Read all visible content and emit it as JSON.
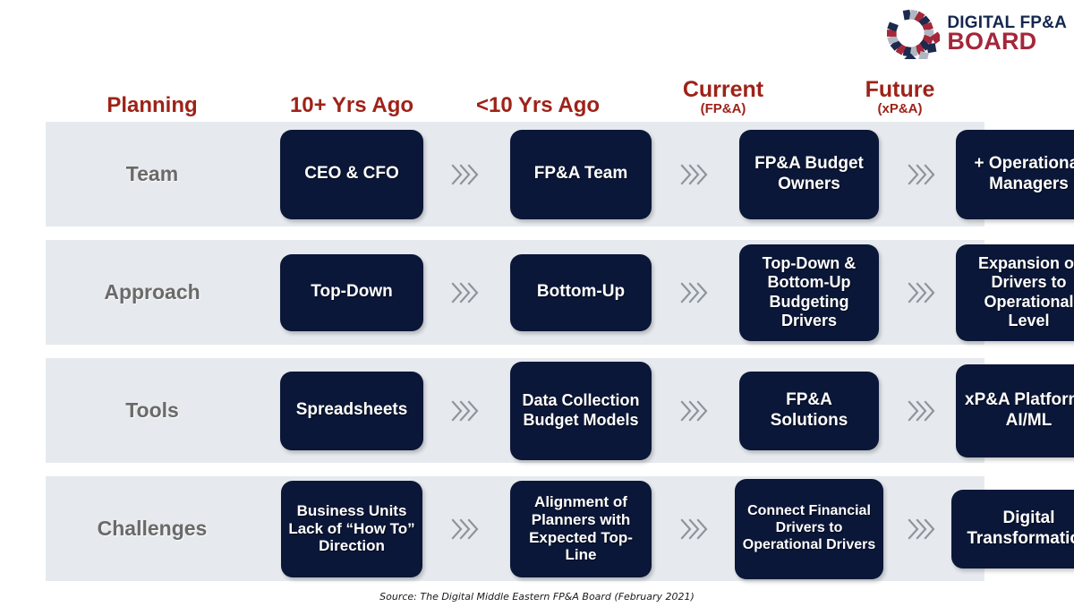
{
  "logo": {
    "line1": "DIGITAL FP&A",
    "line2": "BOARD",
    "mark": "radial-dashes-icon",
    "navy": "#14274e",
    "red": "#a4273a"
  },
  "colors": {
    "header_text": "#9e2218",
    "row_background": "#e6eaee",
    "box_fill": "#0b1738",
    "row_label_text": "#6a6a68",
    "arrow": "#8e949c"
  },
  "headers": [
    {
      "main": "Planning",
      "sub": ""
    },
    {
      "main": "10+ Yrs Ago",
      "sub": ""
    },
    {
      "main": "<10 Yrs Ago",
      "sub": ""
    },
    {
      "main": "Current",
      "sub": "(FP&A)"
    },
    {
      "main": "Future",
      "sub": "(xP&A)"
    }
  ],
  "rows": [
    {
      "label": "Team",
      "cells": [
        "CEO & CFO",
        "FP&A Team",
        "FP&A Budget Owners",
        "+ Operational Managers"
      ]
    },
    {
      "label": "Approach",
      "cells": [
        "Top-Down",
        "Bottom-Up",
        "Top-Down & Bottom-Up Budgeting Drivers",
        "Expansion of Drivers to Operational Level"
      ]
    },
    {
      "label": "Tools",
      "cells": [
        "Spreadsheets",
        "Data Collection Budget Models",
        "FP&A Solutions",
        "xP&A Platforms AI/ML"
      ]
    },
    {
      "label": "Challenges",
      "cells": [
        "Business Units Lack of “How To” Direction",
        "Alignment of Planners with Expected Top-Line",
        "Connect Financial Drivers to Operational Drivers",
        "Digital Transformation"
      ]
    }
  ],
  "arrow_icon": "triple-chevron-right-icon",
  "source": "Source: The Digital Middle Eastern FP&A Board  (February 2021)"
}
